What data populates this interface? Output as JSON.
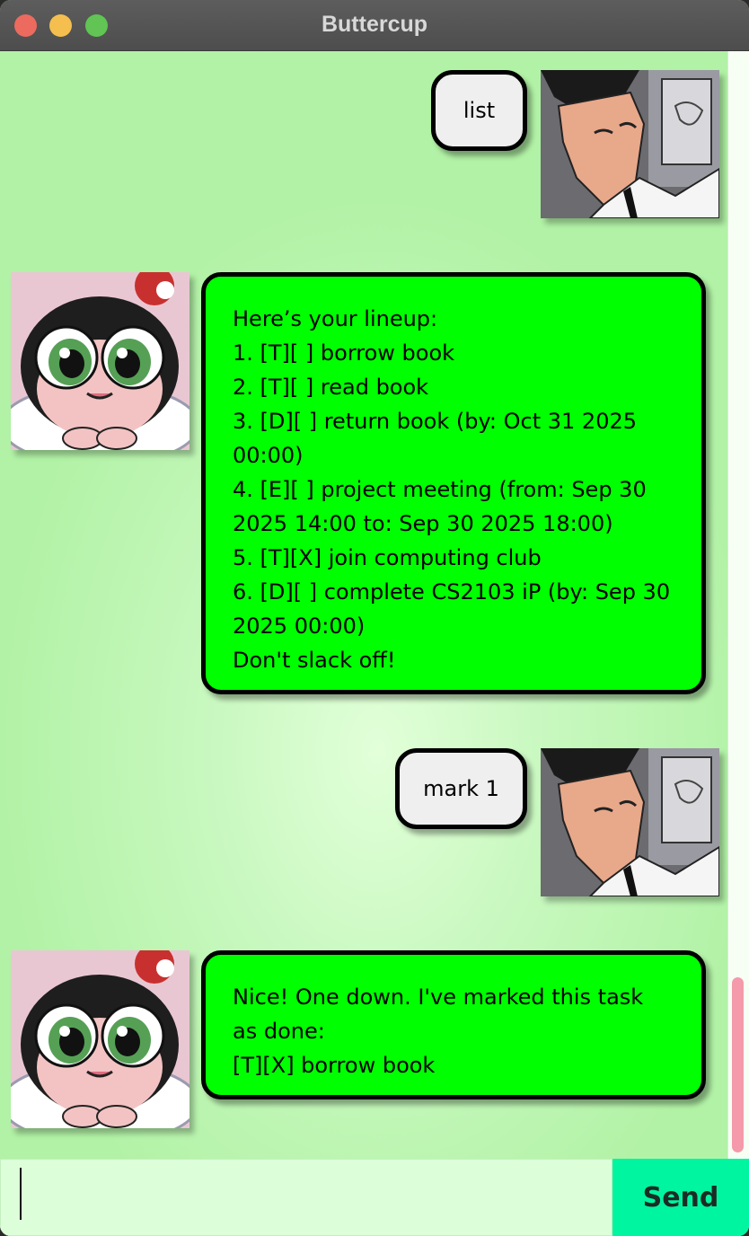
{
  "window": {
    "title": "Buttercup"
  },
  "messages": [
    {
      "role": "user",
      "text": "list"
    },
    {
      "role": "bot",
      "lines": [
        "Here’s your lineup:",
        "1. [T][ ] borrow book",
        "2. [T][ ] read book",
        "3. [D][ ] return book (by: Oct 31 2025 00:00)",
        "4. [E][ ] project meeting (from: Sep 30 2025 14:00 to: Sep 30 2025 18:00)",
        "5. [T][X] join computing club",
        "6. [D][ ] complete CS2103 iP (by: Sep 30 2025 00:00)",
        "Don't slack off!"
      ]
    },
    {
      "role": "user",
      "text": "mark 1"
    },
    {
      "role": "bot",
      "lines": [
        "Nice! One down. I've marked this task as done:",
        "[T][X] borrow book"
      ]
    }
  ],
  "input": {
    "value": "",
    "placeholder": ""
  },
  "send_button": {
    "label": "Send"
  },
  "colors": {
    "bot_bubble": "#00ff00",
    "user_bubble": "#efefef",
    "send": "#00f5a0",
    "scroll_thumb": "#f49aaa"
  },
  "icons": {
    "user_avatar": "professor-utonium-avatar",
    "bot_avatar": "buttercup-avatar"
  }
}
